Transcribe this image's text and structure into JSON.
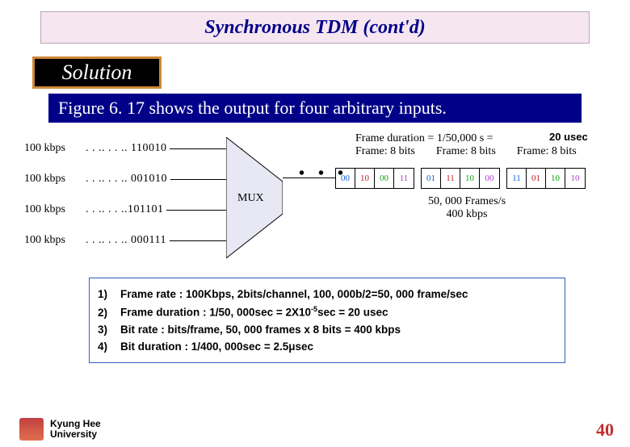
{
  "title": {
    "main": "Synchronous  TDM ",
    "contd": "(cont'd)"
  },
  "solution_label": "Solution",
  "figure_caption": "Figure 6. 17 shows the output for four arbitrary inputs.",
  "diagram": {
    "input_rate": "100 kbps",
    "inputs": [
      {
        "bits": ". . .. . . .. 110010"
      },
      {
        "bits": ". . .. . . .. 001010"
      },
      {
        "bits": ". . .. . . ..101101"
      },
      {
        "bits": ". . .. . . .. 000111"
      }
    ],
    "mux_label": "MUX",
    "ellipsis": "• • •",
    "annotation_usec": "20 usec",
    "frame_duration_line": "Frame duration = 1/50,000 s =",
    "frame_bits_label": "Frame: 8 bits",
    "frames": [
      [
        "00",
        "10",
        "00",
        "11"
      ],
      [
        "01",
        "11",
        "10",
        "00"
      ],
      [
        "11",
        "01",
        "10",
        "10"
      ]
    ],
    "out_rate_line1": "50, 000 Frames/s",
    "out_rate_line2": "400 kbps"
  },
  "calculations": [
    {
      "n": "1)",
      "text": "Frame rate : 100Kbps, 2bits/channel,  100, 000b/2=50, 000 frame/sec"
    },
    {
      "n": "2)",
      "text_pre": "Frame duration : 1/50, 000sec = 2X10",
      "sup": "-5",
      "text_post": "sec = 20 usec"
    },
    {
      "n": "3)",
      "text": "Bit rate : bits/frame, 50, 000 frames  x 8 bits = 400 kbps"
    },
    {
      "n": "4)",
      "text": "Bit duration : 1/400, 000sec = 2.5μsec"
    }
  ],
  "footer": {
    "line1": "Kyung Hee",
    "line2": "University"
  },
  "page_number": "40"
}
